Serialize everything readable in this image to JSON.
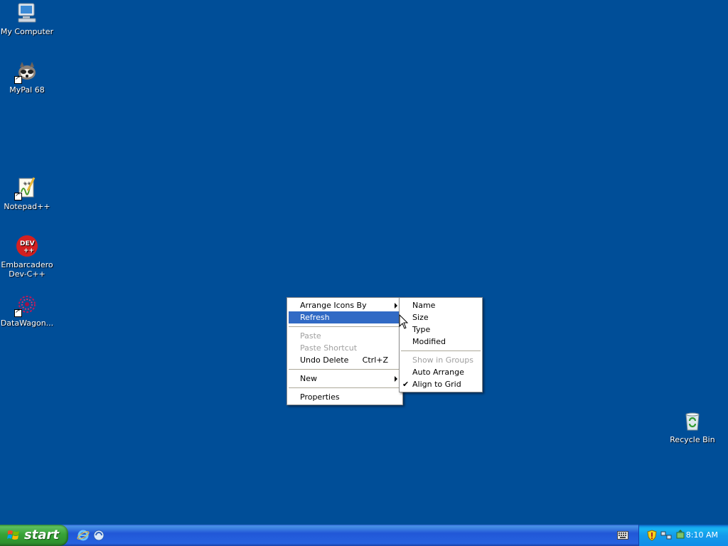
{
  "desktop": {
    "background_color": "#004E98",
    "icons": [
      {
        "label": "My Computer",
        "icon": "computer-icon"
      },
      {
        "label": "MyPal 68",
        "icon": "mypal-icon"
      },
      {
        "label": "Notepad++",
        "icon": "notepad-plus-plus-icon"
      },
      {
        "label": "Embarcadero Dev-C++",
        "label_line1": "Embarcadero",
        "label_line2": "Dev-C++",
        "icon_text": "DEV",
        "icon_text2": "++",
        "icon": "devcpp-icon"
      },
      {
        "label": "DataWagon...",
        "icon": "datawagon-icon"
      },
      {
        "label": "Recycle Bin",
        "icon": "recycle-bin-icon"
      }
    ]
  },
  "context_menu": {
    "items": [
      {
        "label": "Arrange Icons By",
        "submenu": true
      },
      {
        "label": "Refresh",
        "highlighted": true
      },
      {
        "label": "Paste",
        "disabled": true
      },
      {
        "label": "Paste Shortcut",
        "disabled": true
      },
      {
        "label": "Undo Delete",
        "shortcut": "Ctrl+Z"
      },
      {
        "label": "New",
        "submenu": true
      },
      {
        "label": "Properties"
      }
    ]
  },
  "arrange_submenu": {
    "items": [
      {
        "label": "Name"
      },
      {
        "label": "Size"
      },
      {
        "label": "Type"
      },
      {
        "label": "Modified"
      },
      {
        "label": "Show in Groups",
        "disabled": true
      },
      {
        "label": "Auto Arrange"
      },
      {
        "label": "Align to Grid",
        "checked": true
      }
    ]
  },
  "taskbar": {
    "start_label": "start",
    "quick_launch": [
      "internet-explorer-icon",
      "mypal-quicklaunch-icon"
    ],
    "keyboard_icon": "keyboard-icon",
    "tray_icons": [
      "security-shield-icon",
      "network-icon",
      "safely-remove-icon"
    ],
    "clock": "8:10 AM",
    "highlight_color": "#316AC5"
  }
}
